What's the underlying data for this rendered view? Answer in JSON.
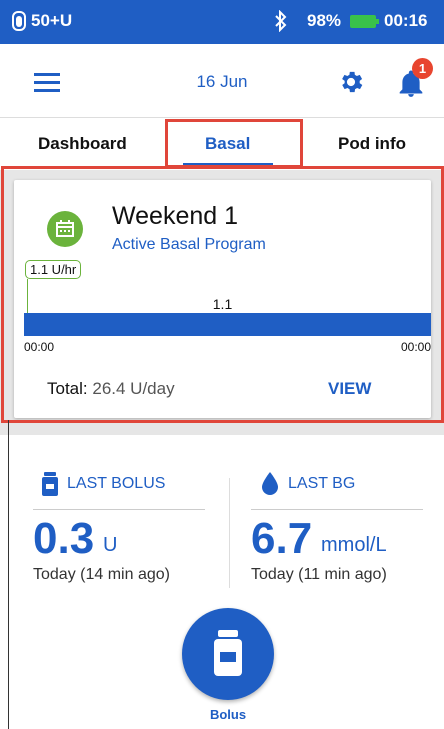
{
  "status_bar": {
    "pod_label": "50+U",
    "battery": "98%",
    "time": "00:16"
  },
  "header": {
    "date": "16 Jun",
    "notification_count": "1"
  },
  "tabs": [
    {
      "label": "Dashboard"
    },
    {
      "label": "Basal"
    },
    {
      "label": "Pod info"
    }
  ],
  "basal_card": {
    "program_name": "Weekend 1",
    "status": "Active Basal Program",
    "current_rate": "1.1 U/hr",
    "segment_value": "1.1",
    "time_start": "00:00",
    "time_end": "00:00",
    "total_label": "Total:",
    "total_value": "26.4 U/day",
    "view_label": "VIEW"
  },
  "last_bolus": {
    "label": "LAST BOLUS",
    "value": "0.3",
    "unit": "U",
    "time": "Today (14 min ago)"
  },
  "last_bg": {
    "label": "LAST BG",
    "value": "6.7",
    "unit": "mmol/L",
    "time": "Today (11 min ago)"
  },
  "bolus_button": {
    "label": "Bolus"
  },
  "colors": {
    "primary": "#1f5ec4",
    "accent_green": "#6bb33c",
    "notification": "#e8452f",
    "highlight": "#e0463a"
  }
}
